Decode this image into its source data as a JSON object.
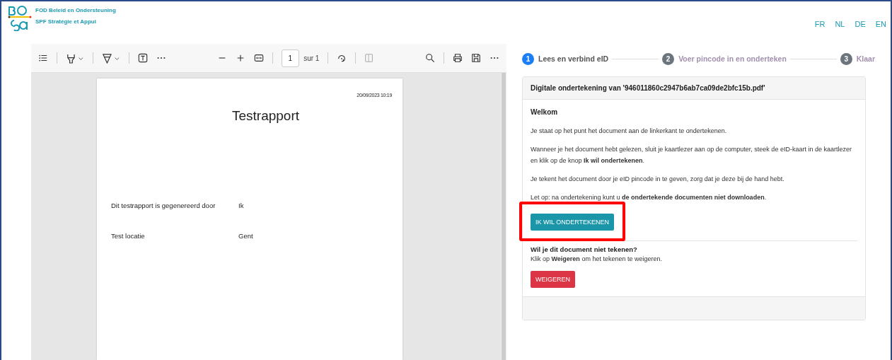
{
  "logo": {
    "org_lines": [
      "FOD Beleid en Ondersteuning",
      "SPF Stratégie et Appui"
    ]
  },
  "languages": [
    {
      "label": "FR",
      "selected": false
    },
    {
      "label": "NL",
      "selected": false
    },
    {
      "label": "DE",
      "selected": false
    },
    {
      "label": "EN",
      "selected": false
    }
  ],
  "pdf_viewer": {
    "toolbar": {
      "page_number": "1",
      "page_total": "sur 1"
    },
    "document": {
      "timestamp": "20/09/2023 10:19",
      "title": "Testrapport",
      "fields": [
        {
          "label": "Dit testrapport is gegenereerd door",
          "value": "Ik"
        },
        {
          "label": "Test locatie",
          "value": "Gent"
        }
      ]
    }
  },
  "steps": [
    {
      "number": "1",
      "label": "Lees en verbind eID",
      "selected": true
    },
    {
      "number": "2",
      "label": "Voer pincode in en onderteken",
      "selected": false
    },
    {
      "number": "3",
      "label": "Klaar",
      "selected": false
    }
  ],
  "card": {
    "header": "Digitale ondertekening van '946011860c2947b6ab7ca09de2bfc15b.pdf'",
    "heading": "Welkom",
    "paragraphs": [
      "Je staat op het punt het document aan de linkerkant te ondertekenen.",
      "Wanneer je het document hebt gelezen, sluit je kaartlezer aan op de computer, steek de eID-kaart in de kaartlezer en klik op de knop **Ik wil ondertekenen**.",
      "Je tekent het document door je eID pincode in te geven, zorg dat je deze bij de hand hebt.",
      "Let op: na ondertekening kunt u **de ondertekende documenten niet downloaden**."
    ],
    "sign_button": {
      "label": "IK WIL ONDERTEKENEN",
      "highlighted": true
    },
    "decline_heading": "Wil je dit document niet tekenen?",
    "decline_text": "Klik op **Weigeren** om het tekenen te weigeren.",
    "decline_button": "WEIGEREN"
  }
}
